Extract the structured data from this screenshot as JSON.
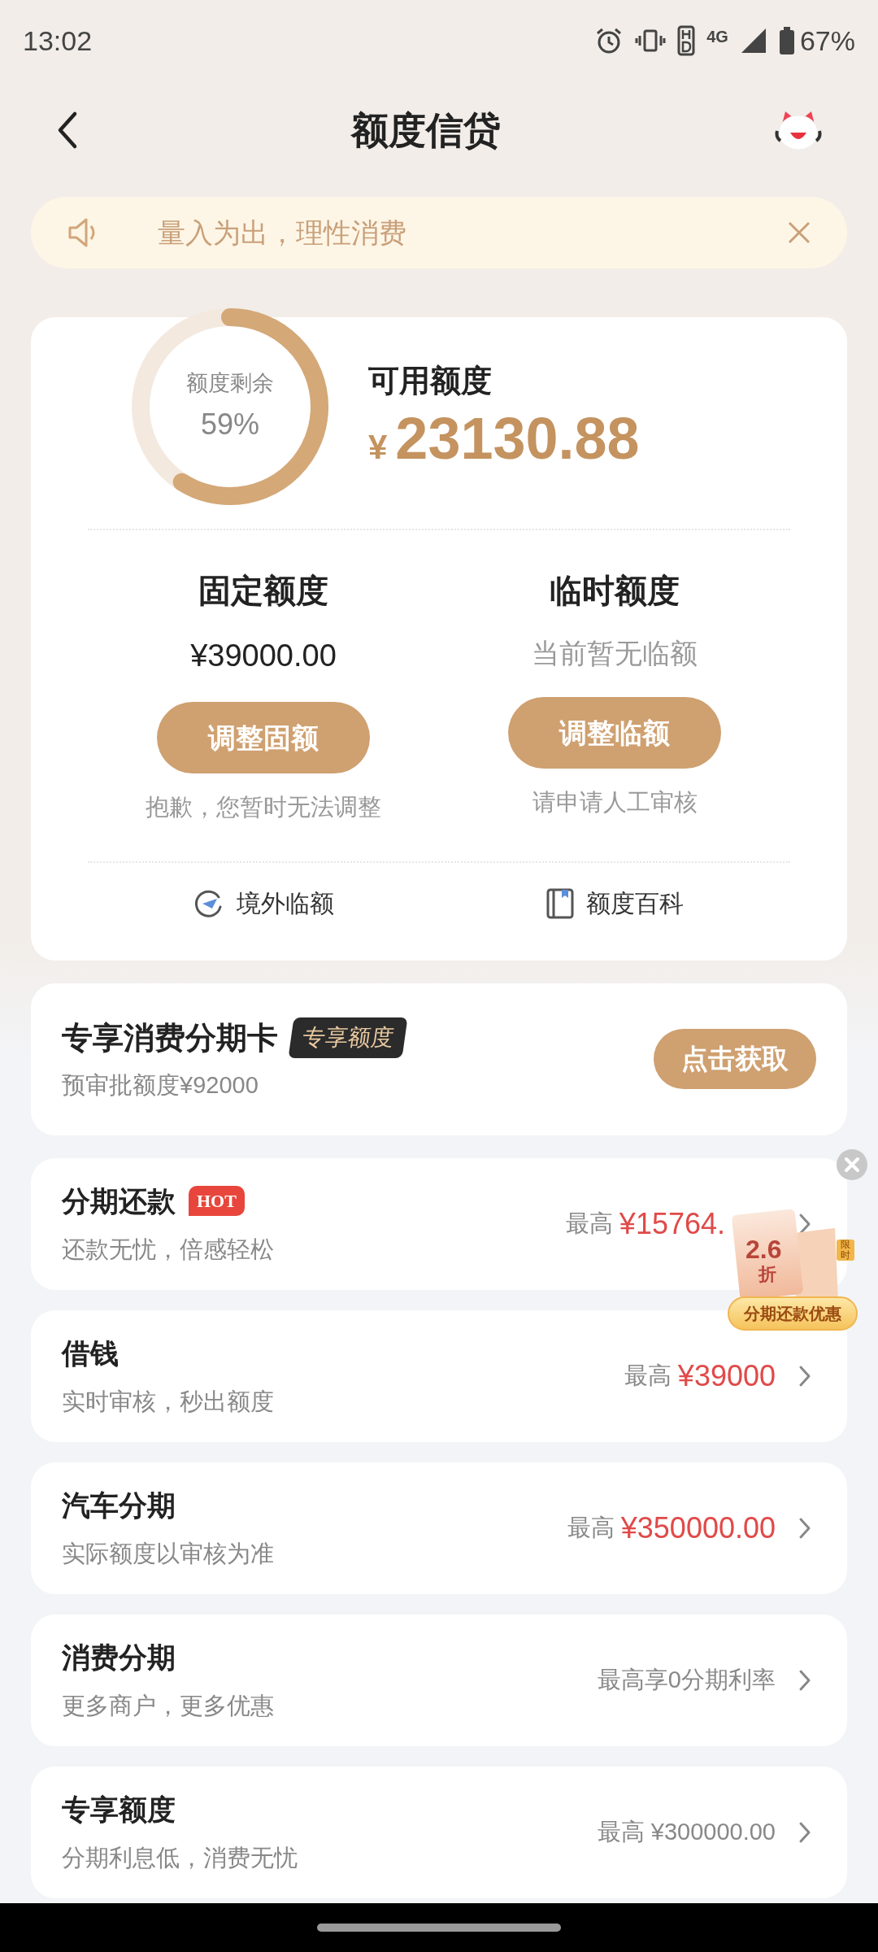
{
  "status_bar": {
    "time": "13:02",
    "network": "4G",
    "battery": "67%"
  },
  "header": {
    "title": "额度信贷"
  },
  "notice": {
    "text": "量入为出，理性消费"
  },
  "credit_card": {
    "ring_label": "额度剩余",
    "ring_percent": "59%",
    "available_label": "可用额度",
    "currency": "¥",
    "available_amount": "23130.88",
    "columns": [
      {
        "title": "固定额度",
        "value": "¥39000.00",
        "kind": "amount",
        "button": "调整固额",
        "note": "抱歉，您暂时无法调整"
      },
      {
        "title": "临时额度",
        "value": "当前暂无临额",
        "kind": "muted",
        "button": "调整临额",
        "note": "请申请人工审核"
      }
    ],
    "links": [
      {
        "kind": "plane",
        "label": "境外临额"
      },
      {
        "kind": "book",
        "label": "额度百科"
      }
    ]
  },
  "promo_card": {
    "title": "专享消费分期卡",
    "tag": "专享额度",
    "subtitle": "预审批额度¥92000",
    "button": "点击获取"
  },
  "products": [
    {
      "title": "分期还款",
      "badge": "HOT",
      "subtitle": "还款无忧，倍感轻松",
      "prefix": "最高",
      "value": "¥15764.",
      "kind": "highlight"
    },
    {
      "title": "借钱",
      "subtitle": "实时审核，秒出额度",
      "prefix": "最高",
      "value": "¥39000",
      "kind": "highlight"
    },
    {
      "title": "汽车分期",
      "subtitle": "实际额度以审核为准",
      "prefix": "最高",
      "value": "¥350000.00",
      "kind": "highlight"
    },
    {
      "title": "消费分期",
      "subtitle": "更多商户，更多优惠",
      "value": "最高享0分期利率",
      "kind": "plain"
    },
    {
      "title": "专享额度",
      "subtitle": "分期利息低，消费无忧",
      "prefix": "最高",
      "value": "¥300000.00",
      "kind": "plain"
    }
  ],
  "floating_promo": {
    "discount": "2.6",
    "unit": "折",
    "tag": "限时",
    "label": "分期还款优惠"
  }
}
